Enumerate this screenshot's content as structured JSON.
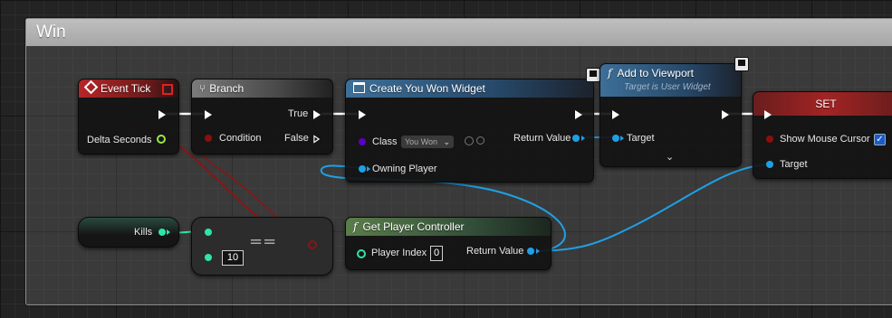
{
  "comment": {
    "title": "Win"
  },
  "nodes": {
    "event_tick": {
      "title": "Event Tick",
      "pin_delta": "Delta Seconds"
    },
    "branch": {
      "title": "Branch",
      "pin_condition": "Condition",
      "pin_true": "True",
      "pin_false": "False"
    },
    "create_widget": {
      "title": "Create You Won Widget",
      "pin_class": "Class",
      "class_value": "You Won",
      "pin_return": "Return Value",
      "pin_owning": "Owning Player"
    },
    "add_to_viewport": {
      "title": "Add to Viewport",
      "subtitle": "Target is User Widget",
      "pin_target": "Target"
    },
    "set_node": {
      "title": "SET",
      "pin_show_cursor": "Show Mouse Cursor",
      "show_cursor_checked": true,
      "pin_target": "Target"
    },
    "kills": {
      "label": "Kills"
    },
    "equals": {
      "operator": "==",
      "input_value": "10"
    },
    "get_player_controller": {
      "title": "Get Player Controller",
      "pin_index": "Player Index",
      "index_value": "0",
      "pin_return": "Return Value"
    }
  },
  "colors": {
    "exec": "#ffffff",
    "bool_pin": "#8c0e0e",
    "int_pin": "#2ee6a4",
    "object_pin": "#1ea0e6",
    "class_pin": "#5a00c8",
    "event_header": "#b52628",
    "function_header": "#3d6f98",
    "pure_header": "#5a7d4a"
  },
  "icons": [
    "event-diamond-icon",
    "branch-icon",
    "widget-icon",
    "function-icon",
    "network-icon",
    "chevron-down-icon",
    "checkmark-icon"
  ]
}
